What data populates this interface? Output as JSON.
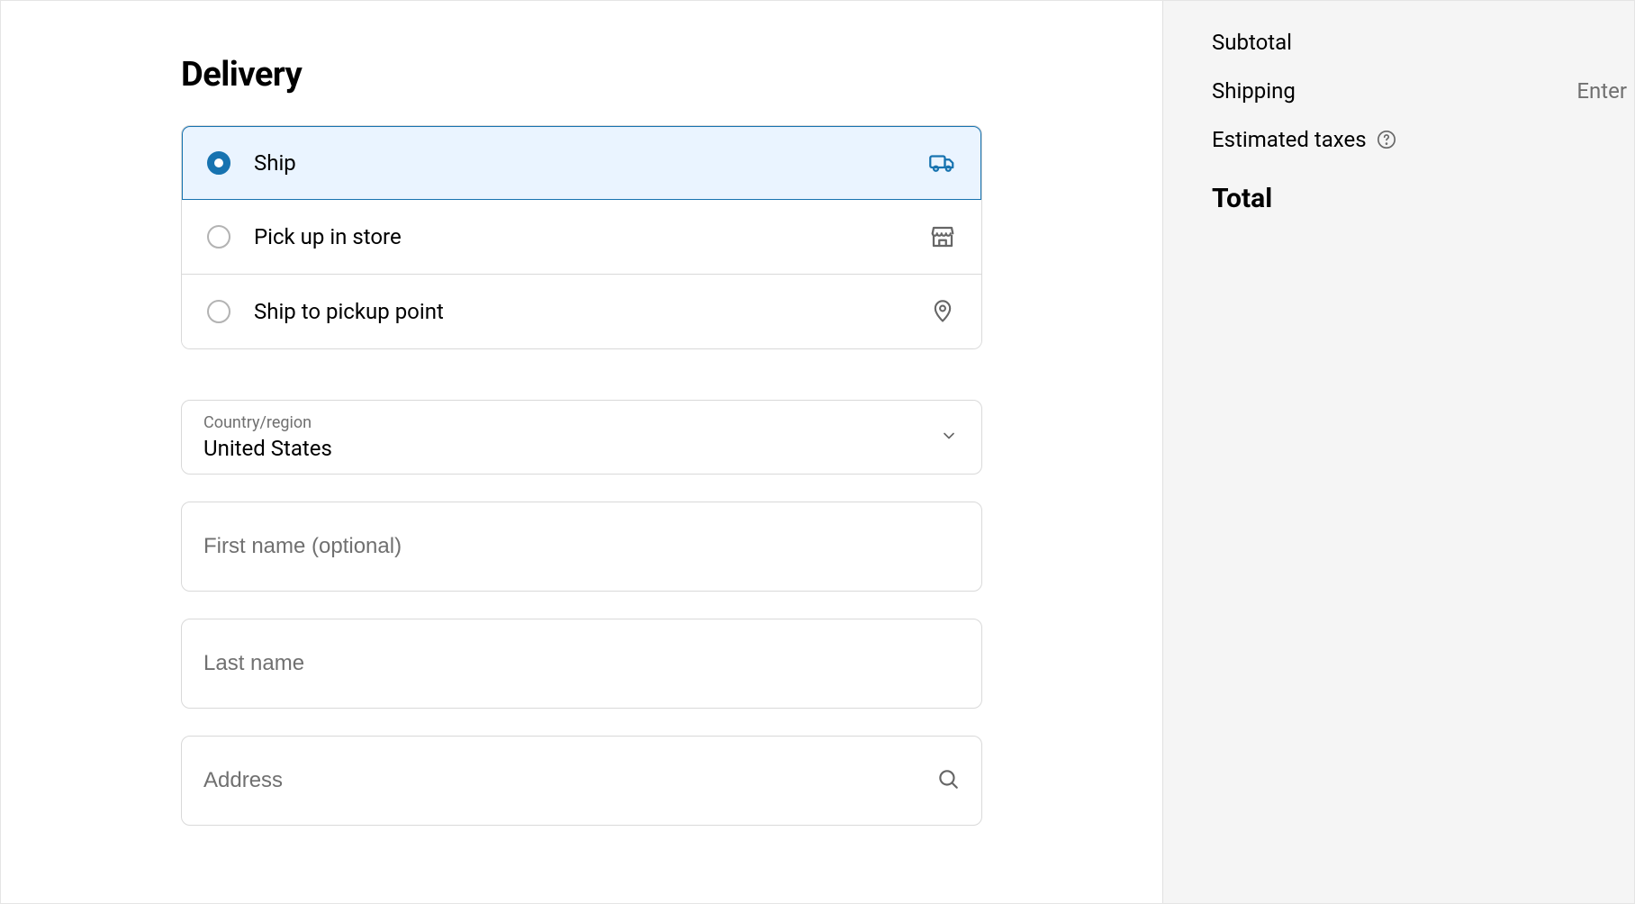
{
  "delivery": {
    "title": "Delivery",
    "options": [
      {
        "label": "Ship"
      },
      {
        "label": "Pick up in store"
      },
      {
        "label": "Ship to pickup point"
      }
    ],
    "country": {
      "label": "Country/region",
      "value": "United States"
    },
    "first_name_placeholder": "First name (optional)",
    "last_name_placeholder": "Last name",
    "address_placeholder": "Address"
  },
  "summary": {
    "subtotal_label": "Subtotal",
    "shipping_label": "Shipping",
    "shipping_value": "Enter",
    "taxes_label": "Estimated taxes",
    "total_label": "Total"
  }
}
